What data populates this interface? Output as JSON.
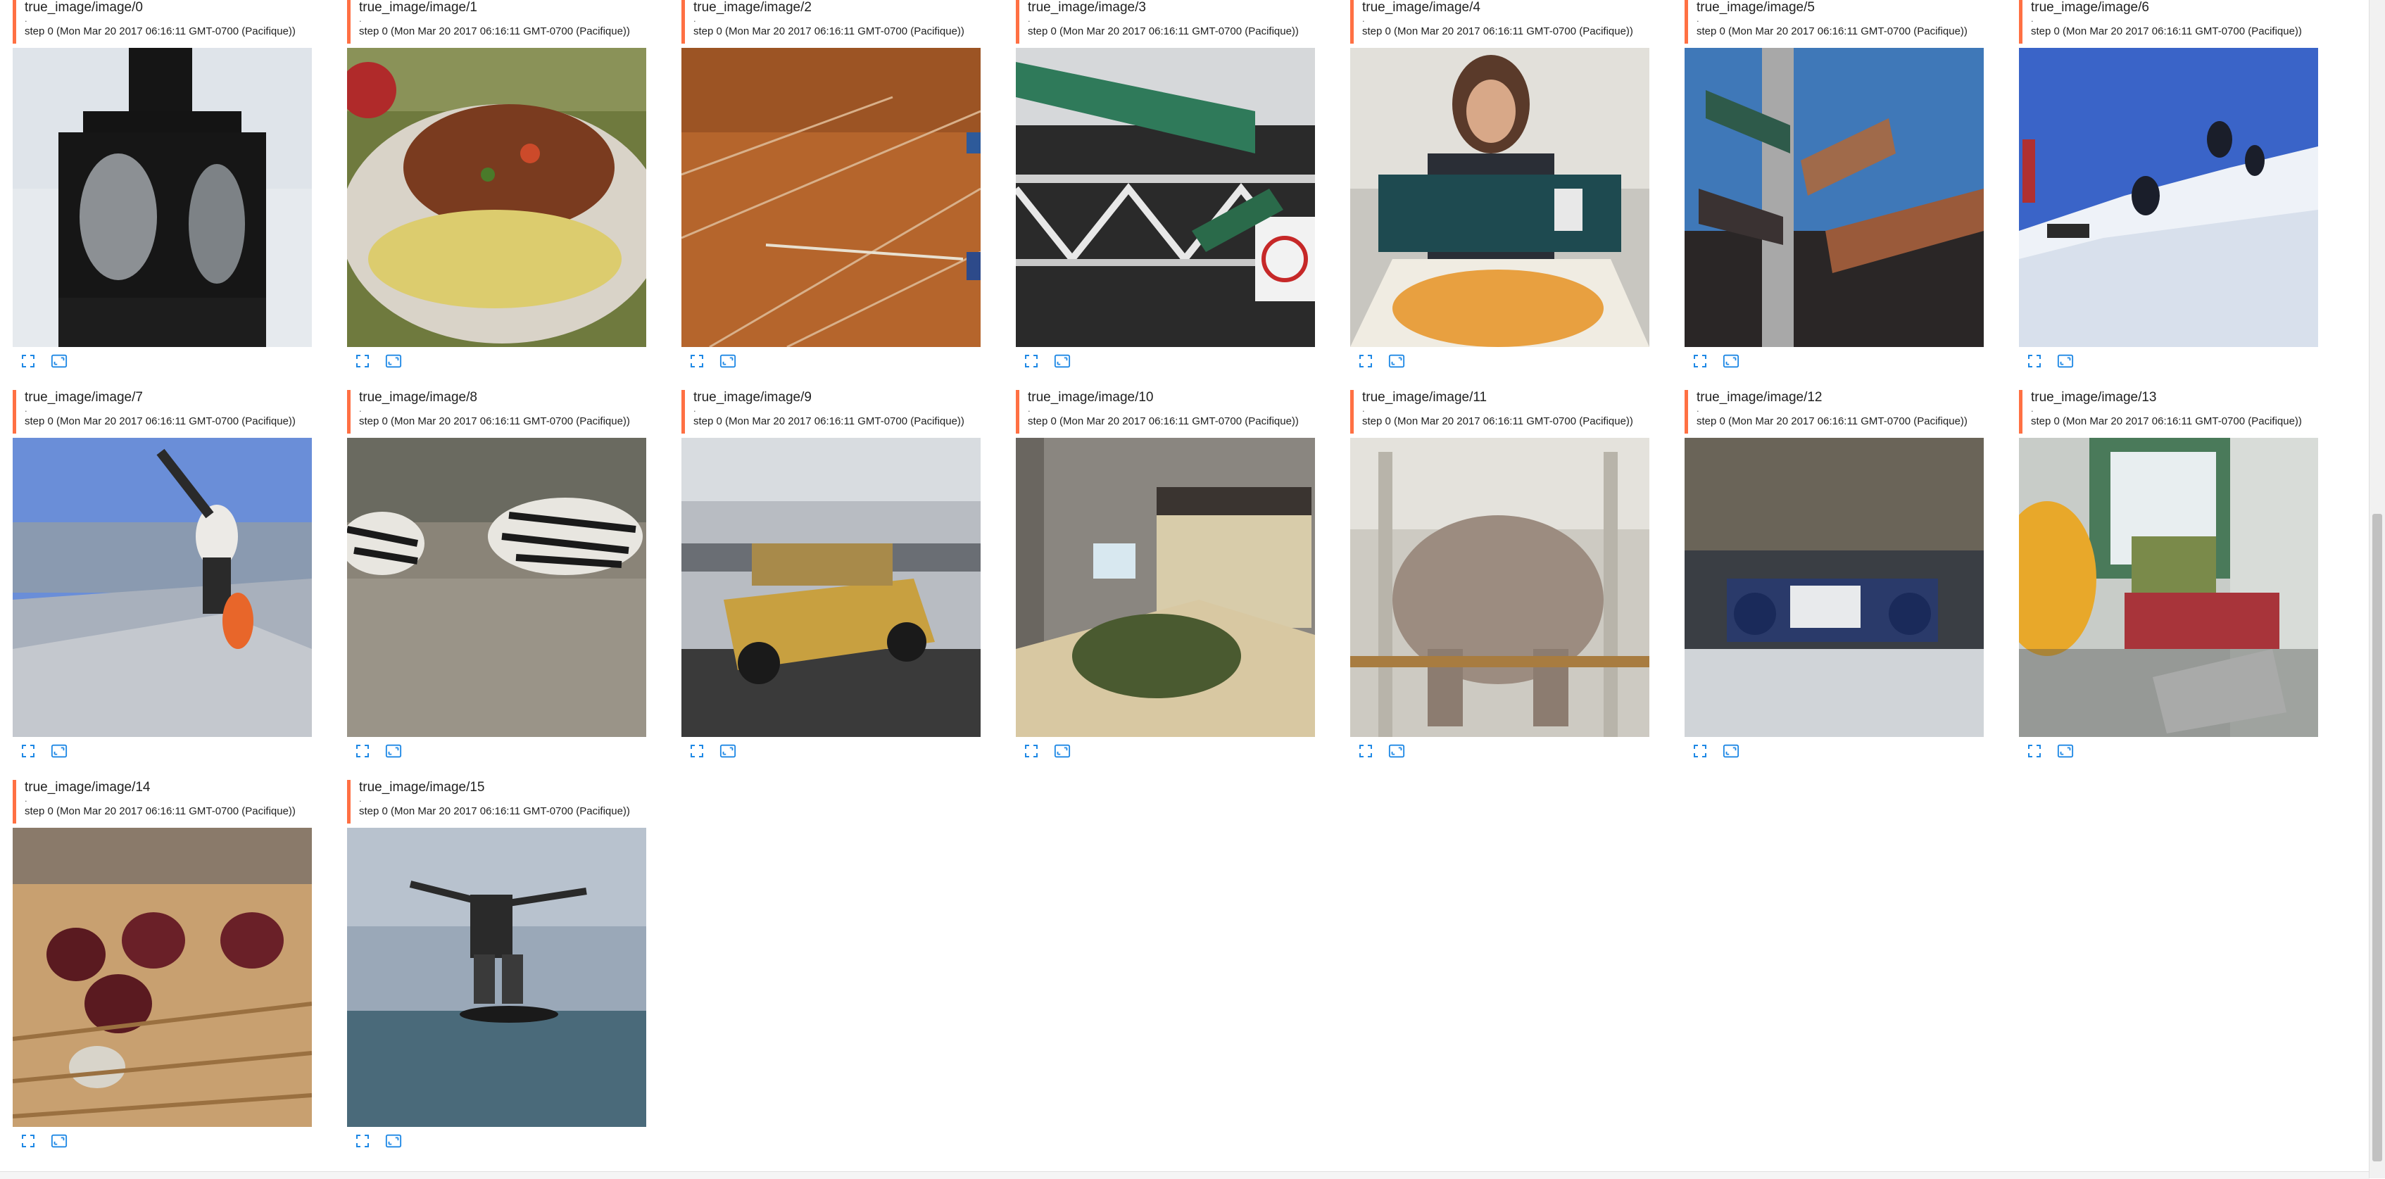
{
  "accent_color": "#ff7043",
  "icon_color": "#1e88e5",
  "cards": [
    {
      "title": "true_image/image/0",
      "dot": ".",
      "step": "step 0 (Mon Mar 20 2017 06:16:11 GMT-0700 (Pacifique))"
    },
    {
      "title": "true_image/image/1",
      "dot": ".",
      "step": "step 0 (Mon Mar 20 2017 06:16:11 GMT-0700 (Pacifique))"
    },
    {
      "title": "true_image/image/2",
      "dot": ".",
      "step": "step 0 (Mon Mar 20 2017 06:16:11 GMT-0700 (Pacifique))"
    },
    {
      "title": "true_image/image/3",
      "dot": ".",
      "step": "step 0 (Mon Mar 20 2017 06:16:11 GMT-0700 (Pacifique))"
    },
    {
      "title": "true_image/image/4",
      "dot": ".",
      "step": "step 0 (Mon Mar 20 2017 06:16:11 GMT-0700 (Pacifique))"
    },
    {
      "title": "true_image/image/5",
      "dot": ".",
      "step": "step 0 (Mon Mar 20 2017 06:16:11 GMT-0700 (Pacifique))"
    },
    {
      "title": "true_image/image/6",
      "dot": ".",
      "step": "step 0 (Mon Mar 20 2017 06:16:11 GMT-0700 (Pacifique))"
    },
    {
      "title": "true_image/image/7",
      "dot": ".",
      "step": "step 0 (Mon Mar 20 2017 06:16:11 GMT-0700 (Pacifique))"
    },
    {
      "title": "true_image/image/8",
      "dot": ".",
      "step": "step 0 (Mon Mar 20 2017 06:16:11 GMT-0700 (Pacifique))"
    },
    {
      "title": "true_image/image/9",
      "dot": ".",
      "step": "step 0 (Mon Mar 20 2017 06:16:11 GMT-0700 (Pacifique))"
    },
    {
      "title": "true_image/image/10",
      "dot": ".",
      "step": "step 0 (Mon Mar 20 2017 06:16:11 GMT-0700 (Pacifique))"
    },
    {
      "title": "true_image/image/11",
      "dot": ".",
      "step": "step 0 (Mon Mar 20 2017 06:16:11 GMT-0700 (Pacifique))"
    },
    {
      "title": "true_image/image/12",
      "dot": ".",
      "step": "step 0 (Mon Mar 20 2017 06:16:11 GMT-0700 (Pacifique))"
    },
    {
      "title": "true_image/image/13",
      "dot": ".",
      "step": "step 0 (Mon Mar 20 2017 06:16:11 GMT-0700 (Pacifique))"
    },
    {
      "title": "true_image/image/14",
      "dot": ".",
      "step": "step 0 (Mon Mar 20 2017 06:16:11 GMT-0700 (Pacifique))"
    },
    {
      "title": "true_image/image/15",
      "dot": ".",
      "step": "step 0 (Mon Mar 20 2017 06:16:11 GMT-0700 (Pacifique))"
    }
  ],
  "icons": {
    "fullscreen": "fullscreen-icon",
    "actual_size": "actual-size-icon"
  }
}
